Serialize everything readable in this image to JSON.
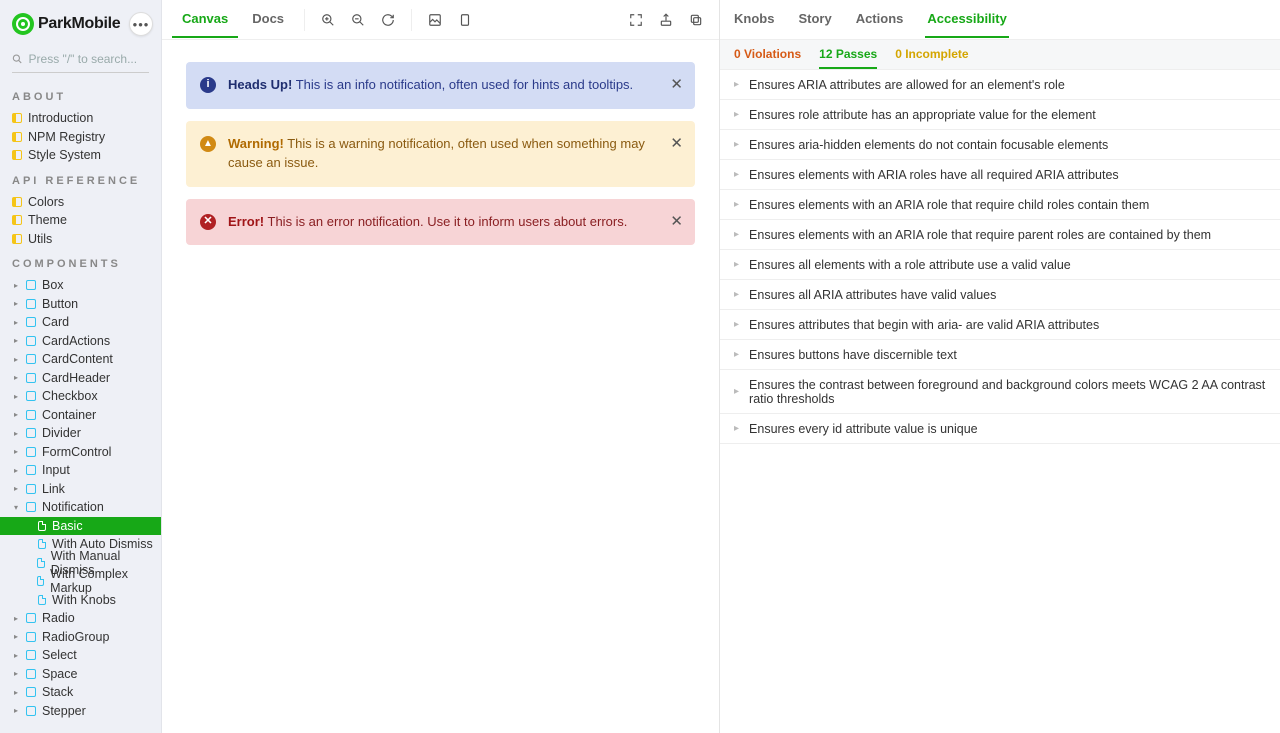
{
  "brand": {
    "name": "ParkMobile"
  },
  "search": {
    "placeholder": "Press \"/\" to search..."
  },
  "sidebar": {
    "sections": [
      {
        "title": "ABOUT",
        "items": [
          {
            "label": "Introduction"
          },
          {
            "label": "NPM Registry"
          },
          {
            "label": "Style System"
          }
        ]
      },
      {
        "title": "API REFERENCE",
        "items": [
          {
            "label": "Colors"
          },
          {
            "label": "Theme"
          },
          {
            "label": "Utils"
          }
        ]
      }
    ],
    "components_title": "COMPONENTS",
    "components": [
      "Box",
      "Button",
      "Card",
      "CardActions",
      "CardContent",
      "CardHeader",
      "Checkbox",
      "Container",
      "Divider",
      "FormControl",
      "Input",
      "Link"
    ],
    "notification": {
      "label": "Notification",
      "stories": [
        "Basic",
        "With Auto Dismiss",
        "With Manual Dismiss",
        "With Complex Markup",
        "With Knobs"
      ],
      "selected": "Basic"
    },
    "components_after": [
      "Radio",
      "RadioGroup",
      "Select",
      "Space",
      "Stack",
      "Stepper"
    ]
  },
  "toolbar": {
    "tabs": {
      "canvas": "Canvas",
      "docs": "Docs"
    }
  },
  "banners": {
    "info": {
      "title": "Heads Up!",
      "body": "This is an info notification, often used for hints and tooltips."
    },
    "warn": {
      "title": "Warning!",
      "body": "This is a warning notification, often used when something may cause an issue."
    },
    "error": {
      "title": "Error!",
      "body": "This is an error notification. Use it to inform users about errors."
    }
  },
  "panel": {
    "tabs": {
      "knobs": "Knobs",
      "story": "Story",
      "actions": "Actions",
      "accessibility": "Accessibility"
    },
    "subtabs": {
      "violations": "0 Violations",
      "passes": "12 Passes",
      "incomplete": "0 Incomplete"
    },
    "rules": [
      "Ensures ARIA attributes are allowed for an element's role",
      "Ensures role attribute has an appropriate value for the element",
      "Ensures aria-hidden elements do not contain focusable elements",
      "Ensures elements with ARIA roles have all required ARIA attributes",
      "Ensures elements with an ARIA role that require child roles contain them",
      "Ensures elements with an ARIA role that require parent roles are contained by them",
      "Ensures all elements with a role attribute use a valid value",
      "Ensures all ARIA attributes have valid values",
      "Ensures attributes that begin with aria- are valid ARIA attributes",
      "Ensures buttons have discernible text",
      "Ensures the contrast between foreground and background colors meets WCAG 2 AA contrast ratio thresholds",
      "Ensures every id attribute value is unique"
    ]
  }
}
